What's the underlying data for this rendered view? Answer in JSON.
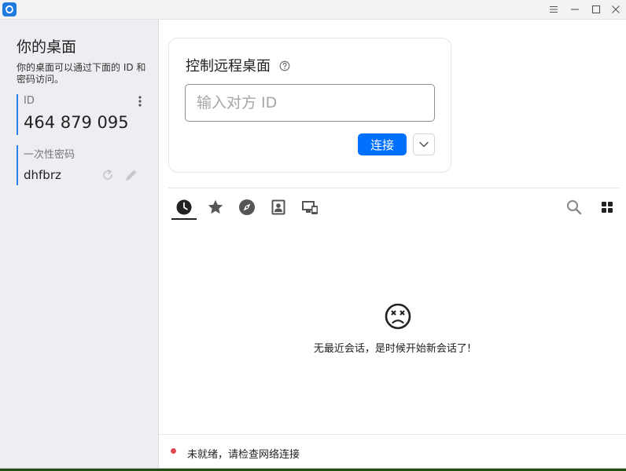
{
  "colors": {
    "accent": "#0071ff",
    "field_border": "#2c82e8",
    "status_error": "#e04850",
    "sidebar_bg": "#eeeef2"
  },
  "titlebar": {
    "icons": [
      "rustdesk-logo-icon",
      "menu-icon",
      "minimize-icon",
      "maximize-icon",
      "close-icon"
    ]
  },
  "sidebar": {
    "title": "你的桌面",
    "description": "你的桌面可以通过下面的 ID 和密码访问。",
    "id_label": "ID",
    "id_value": "464 879 095",
    "password_label": "一次性密码",
    "password_value": "dhfbrz",
    "icons": [
      "kebab-menu-icon",
      "refresh-icon",
      "edit-pencil-icon"
    ]
  },
  "connect_card": {
    "title": "控制远程桌面",
    "input_placeholder": "输入对方 ID",
    "input_value": "",
    "connect_label": "连接",
    "icons": [
      "help-icon",
      "chevron-down-icon"
    ]
  },
  "tabs": [
    {
      "name": "recent-sessions",
      "icon": "clock-icon",
      "active": true
    },
    {
      "name": "favorites",
      "icon": "star-icon",
      "active": false
    },
    {
      "name": "discovered",
      "icon": "compass-icon",
      "active": false
    },
    {
      "name": "address-book",
      "icon": "contact-icon",
      "active": false
    },
    {
      "name": "group",
      "icon": "devices-icon",
      "active": false
    }
  ],
  "toolbar_icons": [
    "search-icon",
    "grid-view-icon"
  ],
  "empty_state": {
    "message": "无最近会话，是时候开始新会话了!",
    "icon": "sad-face-icon"
  },
  "status": {
    "text": "未就绪，请检查网络连接"
  }
}
